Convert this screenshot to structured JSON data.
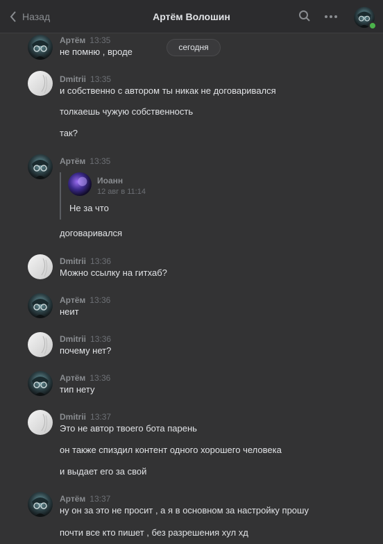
{
  "header": {
    "back_label": "Назад",
    "title": "Артём Волошин"
  },
  "date_divider": "сегодня",
  "messages": [
    {
      "author": "Артём",
      "time": "13:35",
      "lines": [
        "не помню , вроде"
      ]
    },
    {
      "author": "Dmitrii",
      "time": "13:35",
      "lines": [
        "и собственно с автором ты никак не договаривался",
        "толкаешь чужую собственность",
        "так?"
      ]
    },
    {
      "author": "Артём",
      "time": "13:35",
      "reply": {
        "author": "Иоанн",
        "time": "12 авг в 11:14",
        "text": "Не за что"
      },
      "lines": [
        "договаривался"
      ]
    },
    {
      "author": "Dmitrii",
      "time": "13:36",
      "lines": [
        "Можно ссылку на гитхаб?"
      ]
    },
    {
      "author": "Артём",
      "time": "13:36",
      "lines": [
        "неит"
      ]
    },
    {
      "author": "Dmitrii",
      "time": "13:36",
      "lines": [
        "почему нет?"
      ]
    },
    {
      "author": "Артём",
      "time": "13:36",
      "lines": [
        "тип нету"
      ]
    },
    {
      "author": "Dmitrii",
      "time": "13:37",
      "lines": [
        "Это не автор твоего бота парень",
        "он также спиздил контент одного хорошего человека",
        "и выдает его за свой"
      ]
    },
    {
      "author": "Артём",
      "time": "13:37",
      "lines": [
        "ну он за это не просит , а я в основном за настройку прошу",
        "почти все кто пишет , без разрешения хул хд"
      ]
    }
  ]
}
